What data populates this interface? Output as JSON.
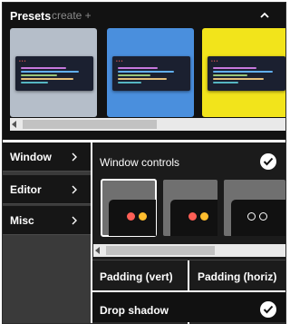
{
  "presets": {
    "title": "Presets",
    "create_label": "create +",
    "items": [
      {
        "bg": "#b5bec9"
      },
      {
        "bg": "#4a8fdd"
      },
      {
        "bg": "#f2e41b"
      }
    ]
  },
  "sidebar": {
    "items": [
      {
        "label": "Window"
      },
      {
        "label": "Editor"
      },
      {
        "label": "Misc"
      }
    ]
  },
  "main": {
    "window_controls": {
      "title": "Window controls",
      "checked": true,
      "options": [
        {
          "style": "colored-two",
          "selected": true
        },
        {
          "style": "colored-two",
          "selected": false
        },
        {
          "style": "outline",
          "selected": false
        }
      ]
    },
    "padding_vert_label": "Padding (vert)",
    "padding_horiz_label": "Padding (horiz)",
    "drop_shadow": {
      "title": "Drop shadow",
      "checked": true
    }
  },
  "colors": {
    "dot_red": "#ff5f56",
    "dot_yellow": "#ffbd2e",
    "panel_bg": "#121212"
  }
}
